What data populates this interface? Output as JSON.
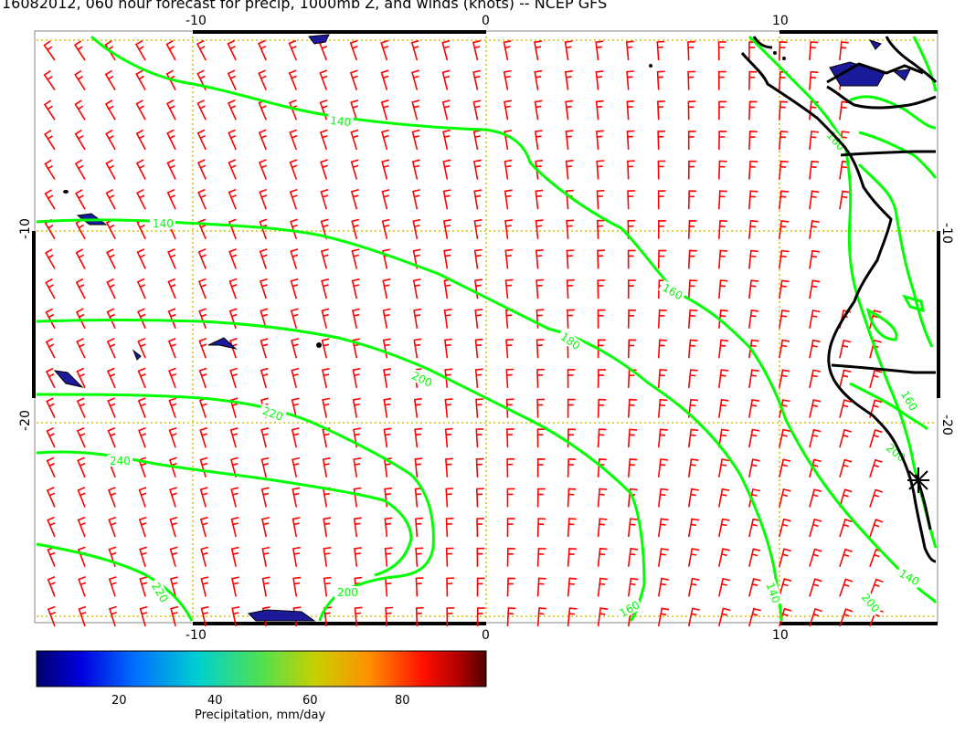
{
  "title": "16082012, 060 hour forecast for precip, 1000mb Z, and winds (knots) -- NCEP GFS",
  "axes": {
    "lon_ticks_top": [
      "-10",
      "0",
      "10"
    ],
    "lon_ticks_bottom": [
      "-10",
      "0",
      "10"
    ],
    "lat_ticks_left": [
      "-10",
      "-20"
    ],
    "lat_ticks_right": [
      "-10",
      "-20"
    ]
  },
  "contour_labels": [
    "140",
    "160",
    "140",
    "160",
    "180",
    "200",
    "220",
    "240",
    "220",
    "200",
    "160",
    "140",
    "160",
    "200",
    "140",
    "200"
  ],
  "colorbar": {
    "label": "Precipitation, mm/day",
    "ticks": [
      "20",
      "40",
      "60",
      "80"
    ],
    "colors": [
      "#00008b",
      "#0000ff",
      "#0080ff",
      "#00e0e0",
      "#40e040",
      "#c0d000",
      "#ffa000",
      "#ff2000",
      "#c00000",
      "#600000"
    ]
  },
  "colors": {
    "contour": "#00ff00",
    "wind_barb": "#ff0000",
    "grid": "#d4c000",
    "coast": "#000000"
  }
}
